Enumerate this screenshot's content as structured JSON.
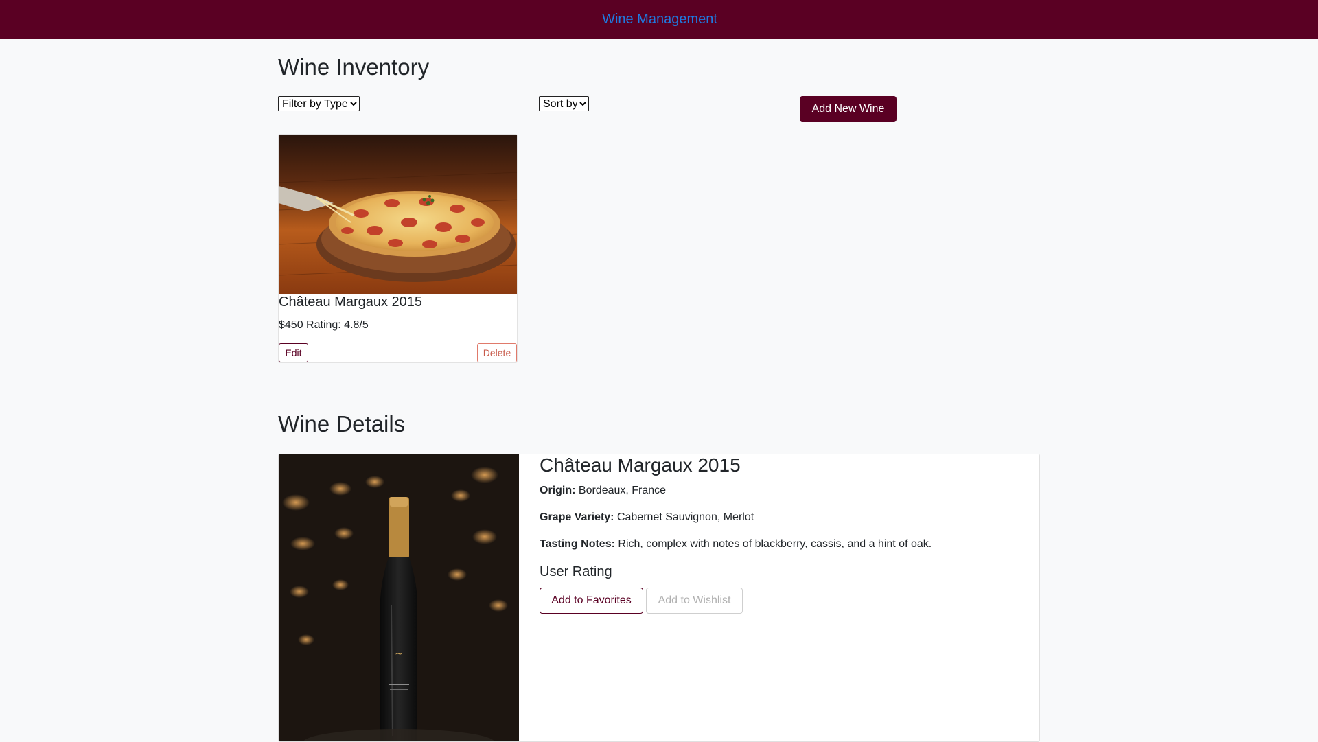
{
  "navbar": {
    "brand": "Wine Management"
  },
  "inventory": {
    "heading": "Wine Inventory",
    "filter": {
      "selected": "Filter by Type"
    },
    "sort": {
      "selected": "Sort by"
    },
    "add_button": "Add New Wine",
    "cards": [
      {
        "name": "Château Margaux 2015",
        "price_rating": "$450 Rating: 4.8/5",
        "edit_label": "Edit",
        "delete_label": "Delete",
        "image": "pizza-photo"
      }
    ]
  },
  "details": {
    "heading": "Wine Details",
    "image": "wine-bottle-photo",
    "name": "Château Margaux 2015",
    "origin_label": "Origin:",
    "origin": "Bordeaux, France",
    "grape_label": "Grape Variety:",
    "grape": "Cabernet Sauvignon, Merlot",
    "notes_label": "Tasting Notes:",
    "notes": "Rich, complex with notes of blackberry, cassis, and a hint of oak.",
    "rating_heading": "User Rating",
    "favorites_label": "Add to Favorites",
    "wishlist_label": "Add to Wishlist"
  },
  "colors": {
    "brand": "#5a0023",
    "link": "#1f7ae0",
    "delete": "#c85a4a"
  }
}
